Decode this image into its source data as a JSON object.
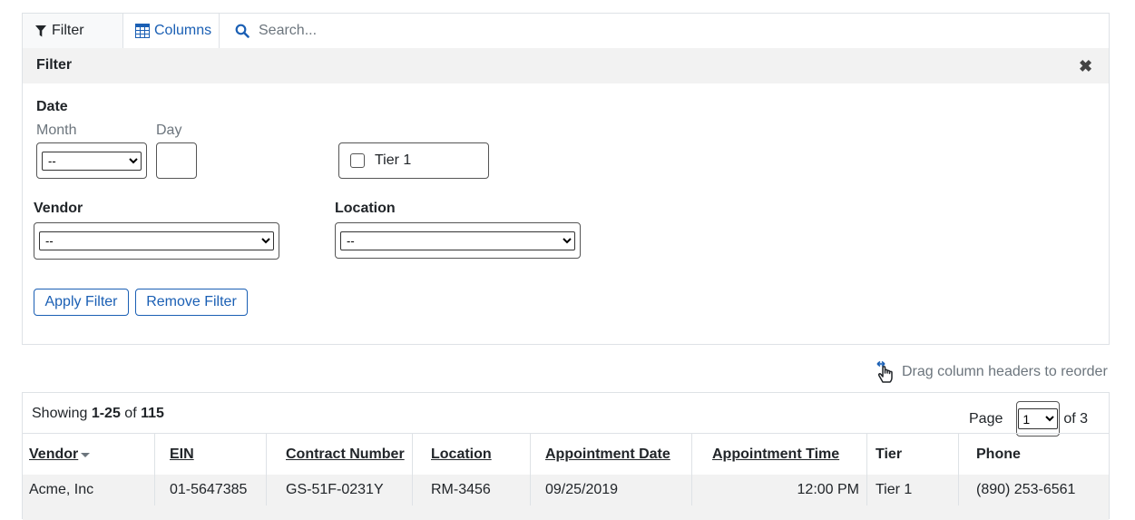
{
  "toolbar": {
    "filter_label": "Filter",
    "columns_label": "Columns",
    "search_placeholder": "Search..."
  },
  "filter_panel": {
    "title": "Filter",
    "date_label": "Date",
    "month_label": "Month",
    "day_label": "Day",
    "month_value": "--",
    "day_value": "",
    "tier_checkbox_label": "Tier 1",
    "tier_checked": false,
    "vendor_label": "Vendor",
    "vendor_value": "--",
    "location_label": "Location",
    "location_value": "--",
    "apply_label": "Apply Filter",
    "remove_label": "Remove Filter"
  },
  "drag_hint": "Drag column headers to reorder",
  "table": {
    "showing_prefix": "Showing ",
    "showing_range": "1-25",
    "showing_of": " of ",
    "showing_total": "115",
    "page_label": "Page",
    "page_value": "1",
    "page_of": "of 3",
    "columns": [
      "Vendor",
      "EIN",
      "Contract Number",
      "Location",
      "Appointment Date",
      "Appointment Time",
      "Tier",
      "Phone"
    ],
    "rows": [
      [
        "Acme, Inc",
        "01-5647385",
        "GS-51F-0231Y",
        "RM-3456",
        "09/25/2019",
        "12:00 PM",
        "Tier 1",
        "(890) 253-6561"
      ]
    ]
  },
  "colors": {
    "link_blue": "#1a5fb4",
    "panel_header_bg": "#f2f2f2",
    "border": "#dee2e6"
  }
}
